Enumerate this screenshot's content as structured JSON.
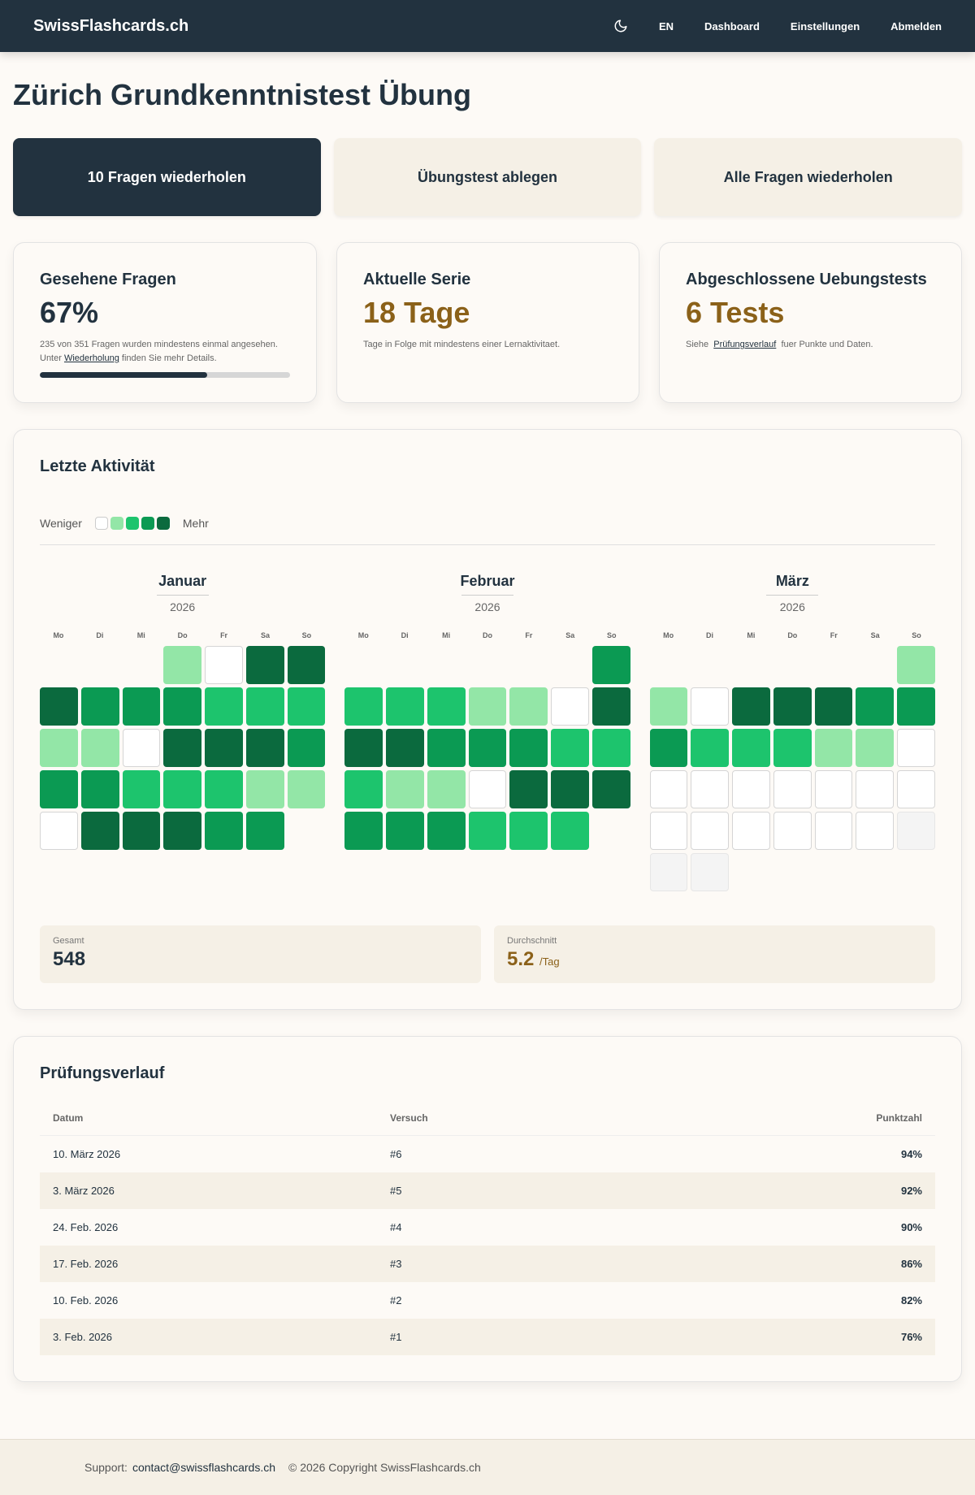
{
  "nav": {
    "brand": "SwissFlashcards.ch",
    "icon": "moon-icon",
    "lang": "EN",
    "dashboard": "Dashboard",
    "settings": "Einstellungen",
    "logout": "Abmelden"
  },
  "page_title": "Zürich Grundkenntnistest Übung",
  "actions": {
    "review10": "10 Fragen wiederholen",
    "practice_test": "Übungstest ablegen",
    "review_all": "Alle Fragen wiederholen"
  },
  "stats": {
    "seen": {
      "label": "Gesehene Fragen",
      "value": "67%",
      "desc_pre": "235 von 351 Fragen wurden mindestens einmal angesehen. Unter",
      "desc_link": "Wiederholung",
      "desc_post": "finden Sie mehr Details.",
      "progress": 0.67
    },
    "streak": {
      "label": "Aktuelle Serie",
      "value": "18 Tage",
      "desc": "Tage in Folge mit mindestens einer Lernaktivitaet."
    },
    "tests": {
      "label": "Abgeschlossene Uebungstests",
      "value": "6 Tests",
      "desc_pre": "Siehe",
      "desc_link": "Prüfungsverlauf",
      "desc_post": "fuer Punkte und Daten."
    }
  },
  "activity": {
    "title": "Letzte Aktivität",
    "legend_less": "Weniger",
    "legend_more": "Mehr",
    "colors": [
      "#ffffff",
      "#93e6a7",
      "#1dc46d",
      "#0b9a53",
      "#0b6a3e"
    ],
    "weekdays": [
      "Mo",
      "Di",
      "Mi",
      "Do",
      "Fr",
      "Sa",
      "So"
    ],
    "months": [
      {
        "name": "Januar",
        "year": "2026",
        "offset": 3,
        "levels": [
          1,
          0,
          4,
          4,
          4,
          3,
          3,
          3,
          2,
          2,
          2,
          1,
          1,
          0,
          4,
          4,
          4,
          3,
          3,
          3,
          2,
          2,
          2,
          1,
          1,
          0,
          4,
          4,
          4,
          3,
          3
        ]
      },
      {
        "name": "Februar",
        "year": "2026",
        "offset": 6,
        "levels": [
          3,
          2,
          2,
          2,
          1,
          1,
          0,
          4,
          4,
          4,
          3,
          3,
          3,
          2,
          2,
          2,
          1,
          1,
          0,
          4,
          4,
          4,
          3,
          3,
          3,
          2,
          2,
          2
        ]
      },
      {
        "name": "März",
        "year": "2026",
        "offset": 6,
        "levels": [
          1,
          1,
          0,
          4,
          4,
          4,
          3,
          3,
          3,
          2,
          2,
          2,
          1,
          1,
          0,
          0,
          0,
          0,
          0,
          0,
          0,
          0,
          0,
          0,
          0,
          0,
          0,
          0,
          "f",
          "f",
          "f"
        ]
      }
    ],
    "total_label": "Gesamt",
    "total_value": "548",
    "avg_label": "Durchschnitt",
    "avg_value": "5.2",
    "avg_unit": "/Tag"
  },
  "exams": {
    "title": "Prüfungsverlauf",
    "headers": [
      "Datum",
      "Versuch",
      "Punktzahl"
    ],
    "rows": [
      {
        "date": "10. März 2026",
        "attempt": "#6",
        "score": "94%"
      },
      {
        "date": "3. März 2026",
        "attempt": "#5",
        "score": "92%"
      },
      {
        "date": "24. Feb. 2026",
        "attempt": "#4",
        "score": "90%"
      },
      {
        "date": "17. Feb. 2026",
        "attempt": "#3",
        "score": "86%"
      },
      {
        "date": "10. Feb. 2026",
        "attempt": "#2",
        "score": "82%"
      },
      {
        "date": "3. Feb. 2026",
        "attempt": "#1",
        "score": "76%"
      }
    ]
  },
  "footer": {
    "support_label": "Support:",
    "email": "contact@swissflashcards.ch",
    "copyright": "© 2026 Copyright SwissFlashcards.ch"
  }
}
